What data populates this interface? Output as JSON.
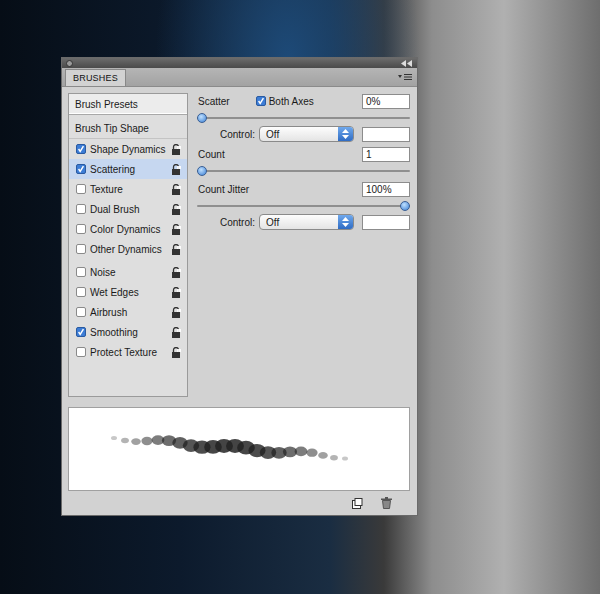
{
  "window": {
    "title": "BRUSHES"
  },
  "sidebar": {
    "headers": [
      {
        "label": "Brush Presets",
        "kind": "button",
        "selected": false
      },
      {
        "label": "Brush Tip Shape",
        "kind": "header",
        "selected": false
      }
    ],
    "dynamics": [
      {
        "label": "Shape Dynamics",
        "checked": true,
        "selected": false
      },
      {
        "label": "Scattering",
        "checked": true,
        "selected": true
      },
      {
        "label": "Texture",
        "checked": false,
        "selected": false
      },
      {
        "label": "Dual Brush",
        "checked": false,
        "selected": false
      },
      {
        "label": "Color Dynamics",
        "checked": false,
        "selected": false
      },
      {
        "label": "Other Dynamics",
        "checked": false,
        "selected": false
      }
    ],
    "options": [
      {
        "label": "Noise",
        "checked": false,
        "selected": false
      },
      {
        "label": "Wet Edges",
        "checked": false,
        "selected": false
      },
      {
        "label": "Airbrush",
        "checked": false,
        "selected": false
      },
      {
        "label": "Smoothing",
        "checked": true,
        "selected": false
      },
      {
        "label": "Protect Texture",
        "checked": false,
        "selected": false
      }
    ]
  },
  "settings": [
    {
      "label": "Scatter",
      "option": {
        "label": "Both Axes",
        "checked": true
      },
      "value": "0%",
      "level": 0,
      "control": {
        "label": "Control:",
        "value": "Off",
        "field": ""
      }
    },
    {
      "label": "Count",
      "value": "1",
      "level": 0
    },
    {
      "label": "Count Jitter",
      "value": "100%",
      "level": 1,
      "control": {
        "label": "Control:",
        "value": "Off",
        "field": ""
      }
    }
  ]
}
